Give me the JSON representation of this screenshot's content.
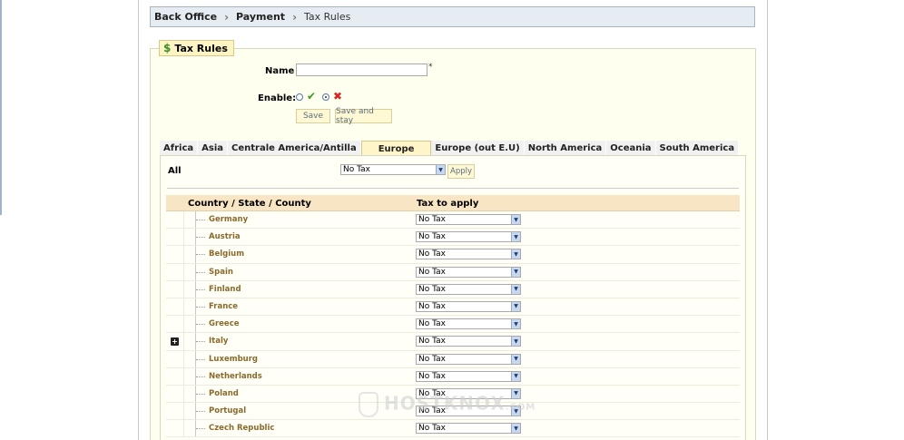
{
  "breadcrumb": {
    "level1": "Back Office",
    "level2": "Payment",
    "current": "Tax Rules"
  },
  "section": {
    "legend": "Tax Rules"
  },
  "form": {
    "name_label": "Name",
    "name_value": "",
    "required_mark": "*",
    "enable_label": "Enable:",
    "enabled": false,
    "save_label": "Save",
    "save_stay_label": "Save and stay"
  },
  "tabs": [
    {
      "label": "Africa",
      "active": false
    },
    {
      "label": "Asia",
      "active": false
    },
    {
      "label": "Centrale America/Antilla",
      "active": false
    },
    {
      "label": "Europe",
      "active": true
    },
    {
      "label": "Europe (out E.U)",
      "active": false
    },
    {
      "label": "North America",
      "active": false
    },
    {
      "label": "Oceania",
      "active": false
    },
    {
      "label": "South America",
      "active": false
    }
  ],
  "apply_all": {
    "label": "All",
    "selected": "No Tax",
    "apply_label": "Apply"
  },
  "table": {
    "col_country": "Country / State / County",
    "col_tax": "Tax to apply",
    "rows": [
      {
        "country": "Germany",
        "tax": "No Tax",
        "expandable": false
      },
      {
        "country": "Austria",
        "tax": "No Tax",
        "expandable": false
      },
      {
        "country": "Belgium",
        "tax": "No Tax",
        "expandable": false
      },
      {
        "country": "Spain",
        "tax": "No Tax",
        "expandable": false
      },
      {
        "country": "Finland",
        "tax": "No Tax",
        "expandable": false
      },
      {
        "country": "France",
        "tax": "No Tax",
        "expandable": false
      },
      {
        "country": "Greece",
        "tax": "No Tax",
        "expandable": false
      },
      {
        "country": "Italy",
        "tax": "No Tax",
        "expandable": true
      },
      {
        "country": "Luxemburg",
        "tax": "No Tax",
        "expandable": false
      },
      {
        "country": "Netherlands",
        "tax": "No Tax",
        "expandable": false
      },
      {
        "country": "Poland",
        "tax": "No Tax",
        "expandable": false
      },
      {
        "country": "Portugal",
        "tax": "No Tax",
        "expandable": false
      },
      {
        "country": "Czech Republic",
        "tax": "No Tax",
        "expandable": false
      }
    ]
  },
  "watermark": {
    "brand": "HOSTKNOX",
    "domain": ".COM"
  },
  "icons": {
    "legend": "dollar-icon",
    "enable_yes": "check-icon",
    "enable_no": "cross-icon",
    "expand": "plus-icon"
  },
  "colors": {
    "accent": "#fff4c4",
    "header_row": "#f8e5c4",
    "country_text": "#8a6a2a",
    "breadcrumb_bg": "#e6edf2"
  }
}
